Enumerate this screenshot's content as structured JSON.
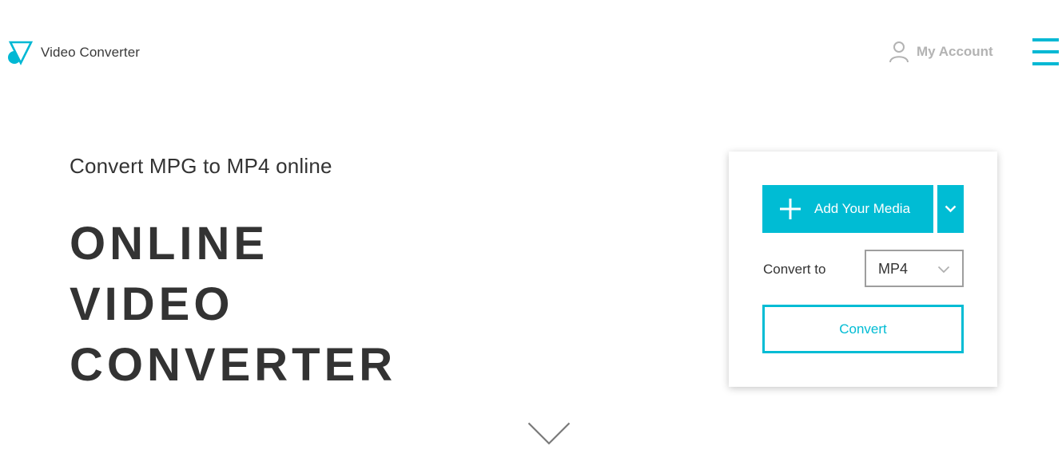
{
  "header": {
    "logo_text": "Video Converter",
    "account_label": "My Account"
  },
  "hero": {
    "subtitle": "Convert MPG to MP4 online",
    "headline": [
      "ONLINE",
      "VIDEO",
      "CONVERTER"
    ]
  },
  "converter": {
    "add_media_label": "Add Your Media",
    "convert_to_label": "Convert to",
    "format_selected": "MP4",
    "convert_button_label": "Convert"
  },
  "icons": {
    "logo": "logo-icon",
    "account": "user-icon",
    "menu": "hamburger-menu-icon",
    "add": "plus-icon",
    "dropdown": "chevron-down-icon",
    "scroll": "chevron-down-icon"
  },
  "colors": {
    "accent": "#00bcd4",
    "text": "#333333",
    "muted": "#b3b3b3",
    "select_border": "#9e9e9e"
  }
}
